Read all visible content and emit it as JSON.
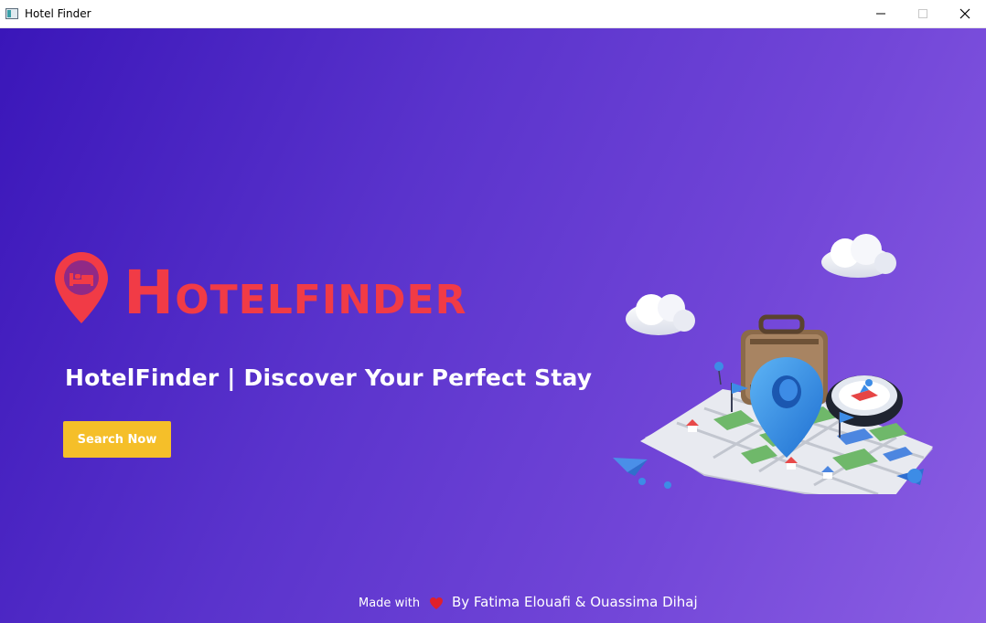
{
  "window": {
    "title": "Hotel Finder"
  },
  "controls": {
    "minimize": "minimize-icon",
    "maximize": "maximize-icon",
    "close": "close-icon"
  },
  "hero": {
    "logo_first_letter": "H",
    "logo_rest": "OTELFINDER",
    "tagline": "HotelFinder | Discover Your Perfect Stay",
    "button_label": "Search Now"
  },
  "footer": {
    "made_with": "Made with",
    "authors": "By Fatima Elouafi & Ouassima Dihaj"
  },
  "colors": {
    "accent_red": "#f13b46",
    "button_yellow": "#f5bf29",
    "gradient_start": "#3a16b9",
    "gradient_end": "#8b5ee3"
  }
}
